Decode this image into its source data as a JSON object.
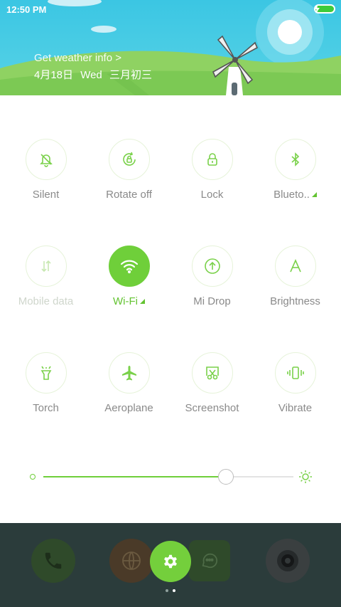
{
  "status_bar": {
    "time": "12:50 PM"
  },
  "weather": {
    "link_text": "Get weather info >",
    "date": "4月18日",
    "weekday": "Wed",
    "lunar_date": "三月初三"
  },
  "toggles": [
    {
      "label": "Silent",
      "icon": "bell-off-icon",
      "state": "off"
    },
    {
      "label": "Rotate off",
      "icon": "rotate-lock-icon",
      "state": "off"
    },
    {
      "label": "Lock",
      "icon": "lock-icon",
      "state": "off"
    },
    {
      "label": "Blueto..",
      "icon": "bluetooth-icon",
      "state": "off",
      "expandable": true
    },
    {
      "label": "Mobile data",
      "icon": "mobile-data-icon",
      "state": "disabled"
    },
    {
      "label": "Wi-Fi",
      "icon": "wifi-icon",
      "state": "on",
      "expandable": true
    },
    {
      "label": "Mi Drop",
      "icon": "mi-drop-icon",
      "state": "off"
    },
    {
      "label": "Brightness",
      "icon": "brightness-auto-icon",
      "state": "off"
    },
    {
      "label": "Torch",
      "icon": "torch-icon",
      "state": "off"
    },
    {
      "label": "Aeroplane",
      "icon": "airplane-icon",
      "state": "off"
    },
    {
      "label": "Screenshot",
      "icon": "screenshot-icon",
      "state": "off"
    },
    {
      "label": "Vibrate",
      "icon": "vibrate-icon",
      "state": "off"
    }
  ],
  "brightness": {
    "level_fraction": 0.73
  },
  "dock": {
    "apps": [
      "phone-icon",
      "browser-icon",
      "messages-icon",
      "camera-icon"
    ],
    "page_count": 2,
    "active_page": 2
  },
  "colors": {
    "accent": "#6fcf3a",
    "sky": "#38c8e3",
    "grass": "#8bd25a",
    "dock": "#2b3c3b"
  }
}
